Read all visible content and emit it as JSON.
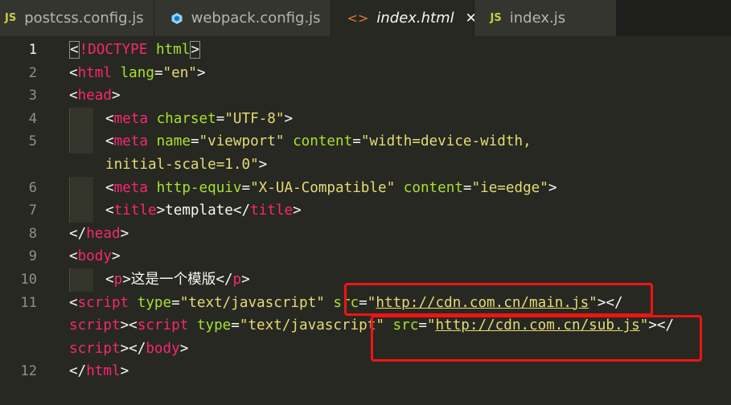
{
  "tabs": [
    {
      "label": "postcss.config.js",
      "icon": "js-file-icon",
      "icon_text": "JS",
      "active": false
    },
    {
      "label": "webpack.config.js",
      "icon": "webpack-icon",
      "active": false
    },
    {
      "label": "index.html",
      "icon": "html-file-icon",
      "icon_text": "<>",
      "active": true,
      "close": "✕"
    },
    {
      "label": "index.js",
      "icon": "js-file-icon",
      "icon_text": "JS",
      "active": false
    }
  ],
  "line_numbers": [
    "1",
    "2",
    "3",
    "4",
    "5",
    "6",
    "7",
    "8",
    "9",
    "10",
    "11",
    "12"
  ],
  "code": {
    "doctype": "!DOCTYPE",
    "html_word": "html",
    "lang_attr": "lang",
    "lang_val": "\"en\"",
    "head": "head",
    "meta": "meta",
    "charset_attr": "charset",
    "charset_val": "\"UTF-8\"",
    "name_attr": "name",
    "name_val": "\"viewport\"",
    "content_attr": "content",
    "viewport_val_1": "\"width=device-width,",
    "viewport_val_2": "initial-scale=1.0\"",
    "httpequiv_attr": "http-equiv",
    "httpequiv_val": "\"X-UA-Compatible\"",
    "ie_val": "\"ie=edge\"",
    "title": "title",
    "title_text": "template",
    "body": "body",
    "p": "p",
    "p_text": "这是一个模版",
    "script": "script",
    "script_part": "script",
    "type_attr": "type",
    "type_val": "\"text/javascript\"",
    "src_attr": "src",
    "src_main": "http://cdn.com.cn/main.js",
    "src_sub": "http://cdn.com.cn/sub.js",
    "q": "\""
  },
  "colors": {
    "tag": "#f92672",
    "attr": "#a6e22e",
    "string": "#e6db74",
    "annotation": "#ef1414"
  }
}
